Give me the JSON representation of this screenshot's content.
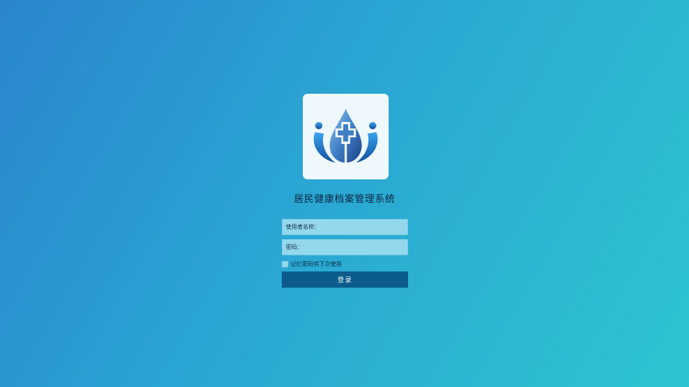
{
  "app": {
    "title": "居民健康档案管理系统"
  },
  "logo": {
    "icon": "blood-drop-medical-cross-icon",
    "colors": {
      "drop": "#2f6fb5",
      "figures": "#1f6fc0",
      "cross": "#ffffff"
    }
  },
  "form": {
    "username_label": "使用者名称：",
    "username_value": "",
    "password_label": "密码：",
    "password_value": "",
    "remember_label": "记忆密码供下次使用",
    "remember_checked": false,
    "login_label": "登录"
  },
  "theme": {
    "bg_start": "#2a86cd",
    "bg_end": "#2cc5d0",
    "button": "#0b5c8c",
    "field_bg": "#93d8ec"
  }
}
